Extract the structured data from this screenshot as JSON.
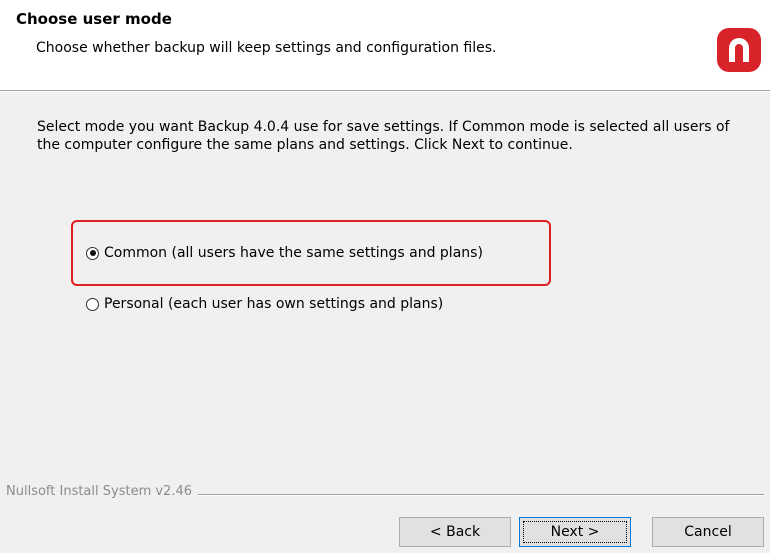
{
  "header": {
    "title": "Choose user mode",
    "subtitle": "Choose whether backup will keep settings and configuration files.",
    "logo_icon": "backup-logo-icon",
    "logo_color": "#d8232a"
  },
  "main": {
    "description": "Select mode you want Backup 4.0.4  use for save settings. If Common mode is selected all users of the computer configure the same plans and settings. Click Next to continue.",
    "options": [
      {
        "label": "Common (all users have the same settings and plans)",
        "checked": true
      },
      {
        "label": "Personal (each user has own settings and plans)",
        "checked": false
      }
    ],
    "highlight_color": "#e02020"
  },
  "footer": {
    "brand": "Nullsoft Install System v2.46",
    "back_label": "< Back",
    "next_label": "Next >",
    "cancel_label": "Cancel"
  }
}
